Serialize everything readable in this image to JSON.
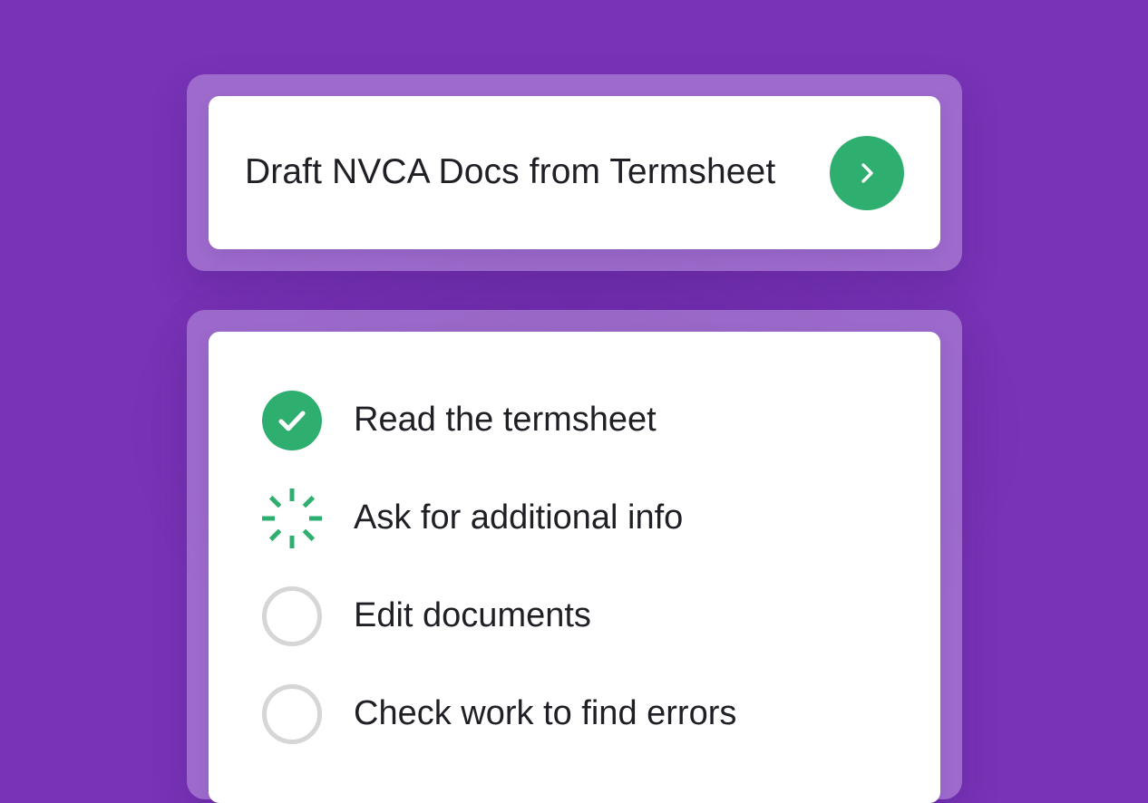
{
  "colors": {
    "background": "#7833b6",
    "accent_green": "#2eaf6f",
    "pending_gray": "#d6d6d6"
  },
  "task": {
    "title": "Draft NVCA Docs from Termsheet",
    "action_icon": "chevron-right-icon"
  },
  "steps": [
    {
      "label": "Read the termsheet",
      "status": "done",
      "icon": "check-circle-icon"
    },
    {
      "label": "Ask for additional info",
      "status": "in-progress",
      "icon": "loading-spinner-icon"
    },
    {
      "label": "Edit documents",
      "status": "pending",
      "icon": "empty-circle-icon"
    },
    {
      "label": "Check work to find errors",
      "status": "pending",
      "icon": "empty-circle-icon"
    }
  ]
}
